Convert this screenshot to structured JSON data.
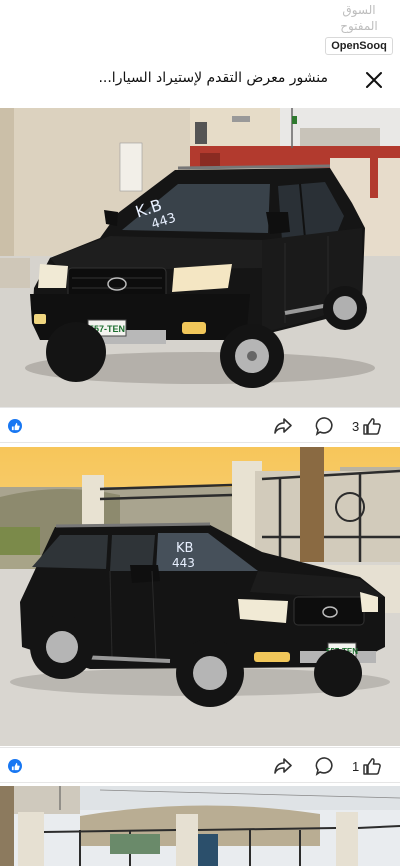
{
  "watermark": {
    "arabic": "السوق المفتوح",
    "brand": "OpenSooq"
  },
  "header": {
    "title": "منشور معرض التقدم  لإستيراد السيارا...",
    "close_icon": "close-icon"
  },
  "posts": [
    {
      "likes": "3",
      "plate": "557-TEN",
      "windshield": "K.B 443"
    },
    {
      "likes": "1",
      "plate": "557-TEN",
      "windshield": "KB 443"
    }
  ],
  "colors": {
    "facebook_blue": "#1877f2",
    "car": "#141414",
    "sky_top": "#f7c65a",
    "ground": "#d9d6d0"
  }
}
